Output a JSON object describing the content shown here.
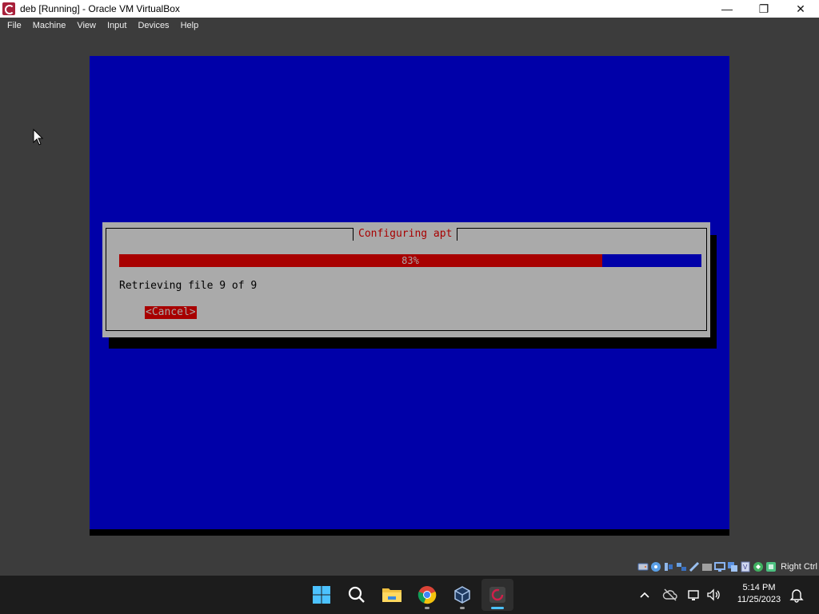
{
  "window": {
    "title": "deb [Running] - Oracle VM VirtualBox",
    "controls": {
      "minimize": "—",
      "maximize": "❐",
      "close": "✕"
    }
  },
  "menu": [
    "File",
    "Machine",
    "View",
    "Input",
    "Devices",
    "Help"
  ],
  "installer": {
    "dialog_title": "Configuring apt",
    "progress_percent": 83,
    "progress_label": "83%",
    "status": "Retrieving file 9 of 9",
    "cancel_label": "<Cancel>"
  },
  "statusbar": {
    "host_key_label": "Right Ctrl",
    "icons": [
      "hard-disk-icon",
      "optical-drive-icon",
      "audio-icon",
      "network-icon",
      "usb-icon",
      "shared-folders-icon",
      "display-icon",
      "video-capture-icon",
      "cpu-icon",
      "mouse-integration-icon",
      "keyboard-icon"
    ]
  },
  "taskbar": {
    "apps": [
      "start-icon",
      "search-icon",
      "file-explorer-icon",
      "chrome-icon",
      "virtualbox-manager-icon",
      "debian-vm-icon"
    ],
    "time": "5:14 PM",
    "date": "11/25/2023"
  },
  "colors": {
    "vm_background": "#0000a8",
    "dialog_background": "#aaaaaa",
    "accent_red": "#a80000",
    "taskbar": "#1c1c1c"
  }
}
